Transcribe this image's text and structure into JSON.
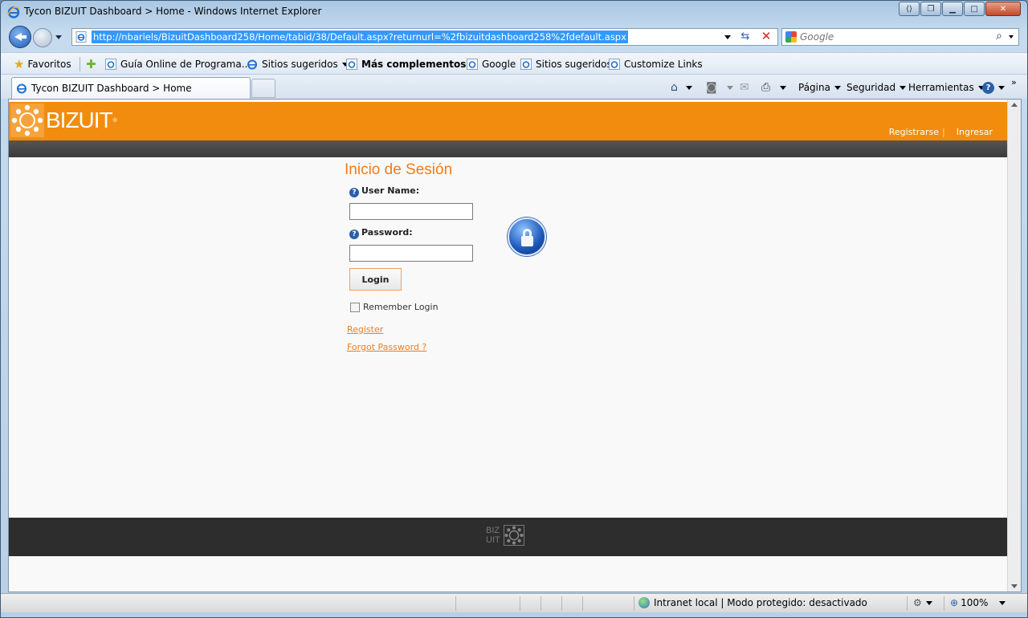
{
  "window": {
    "title": "Tycon BIZUIT Dashboard > Home - Windows Internet Explorer",
    "controls": {
      "back_glyph": "⟨⟩",
      "restore_glyph": "❐",
      "minimize_glyph": "▁",
      "maximize_glyph": "□",
      "close_glyph": "✕"
    }
  },
  "addressbar": {
    "url": "http://nbariels/BizuitDashboard258/Home/tabid/38/Default.aspx?returnurl=%2fbizuitdashboard258%2fdefault.aspx",
    "refresh_glyph": "⇆",
    "stop_glyph": "✕"
  },
  "search": {
    "placeholder": "Google",
    "icon": "search-icon",
    "glyph": "⌕"
  },
  "favorites": {
    "label": "Favoritos",
    "items": [
      {
        "label": "Guía Online de Programa..."
      },
      {
        "label": "Sitios sugeridos"
      },
      {
        "label": "Más complementos"
      },
      {
        "label": "Google"
      },
      {
        "label": "Sitios sugeridos"
      },
      {
        "label": "Customize Links"
      }
    ]
  },
  "tabs": {
    "active": "Tycon BIZUIT Dashboard > Home"
  },
  "commandbar": {
    "home_glyph": "⌂",
    "feeds_glyph": "◙",
    "mail_glyph": "✉",
    "print_glyph": "⎙",
    "pagina": "Página",
    "seguridad": "Seguridad",
    "herramientas": "Herramientas",
    "help_glyph": "?",
    "overflow": "»"
  },
  "site": {
    "logo_text": "BIZUIT",
    "logo_reg": "®",
    "header_links": {
      "register": "Registrarse",
      "separator": "|",
      "login": "Ingresar"
    },
    "login": {
      "title": "Inicio de Sesión",
      "help_glyph": "?",
      "username_label": "User Name:",
      "username_value": "",
      "password_label": "Password:",
      "password_value": "",
      "button": "Login",
      "remember": "Remember Login",
      "register_link": "Register",
      "forgot_link": "Forgot Password ?"
    },
    "footer_logo": {
      "line1": "BIZ",
      "line2": "UIT"
    }
  },
  "statusbar": {
    "zone": "Intranet local | Modo protegido: desactivado",
    "zoom": "100%",
    "zoom_glyph": "⊕",
    "settings_glyph": "⚙"
  },
  "colors": {
    "accent": "#f28c0e",
    "link": "#f07c1e",
    "footer": "#2d2d2d"
  }
}
